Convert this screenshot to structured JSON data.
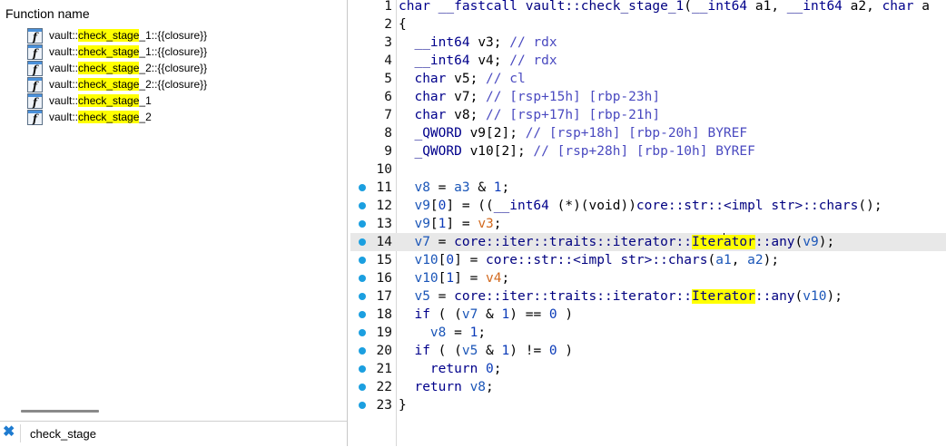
{
  "function_panel": {
    "header": "Function name",
    "search_highlight": "check_stage",
    "functions": [
      {
        "prefix": "vault::",
        "match": "check_stage",
        "suffix": "_1::{{closure}}"
      },
      {
        "prefix": "vault::",
        "match": "check_stage",
        "suffix": "_1::{{closure}}"
      },
      {
        "prefix": "vault::",
        "match": "check_stage",
        "suffix": "_2::{{closure}}"
      },
      {
        "prefix": "vault::",
        "match": "check_stage",
        "suffix": "_2::{{closure}}"
      },
      {
        "prefix": "vault::",
        "match": "check_stage",
        "suffix": "_1"
      },
      {
        "prefix": "vault::",
        "match": "check_stage",
        "suffix": "_2"
      }
    ],
    "function_icon": "function-icon",
    "filter": {
      "value": "check_stage",
      "clear_icon": "close-x-icon"
    }
  },
  "colors": {
    "highlight": "#ffff00",
    "breakpoint_dot": "#1b9fe0",
    "current_line": "#e8e8e8"
  },
  "code_view": {
    "current_line": 14,
    "lines": [
      {
        "n": "1",
        "dot": false,
        "segs": [
          [
            "kw",
            "char __fastcall "
          ],
          [
            "fn",
            "vault::check_stage_1"
          ],
          [
            "",
            "("
          ],
          [
            "kw",
            "__int64 "
          ],
          [
            "",
            "a1, "
          ],
          [
            "kw",
            "__int64 "
          ],
          [
            "",
            "a2, "
          ],
          [
            "kw",
            "char "
          ],
          [
            "",
            "a"
          ]
        ]
      },
      {
        "n": "2",
        "dot": false,
        "segs": [
          [
            "",
            "{"
          ]
        ]
      },
      {
        "n": "3",
        "dot": false,
        "segs": [
          [
            "kw",
            "  __int64 "
          ],
          [
            "",
            "v3; "
          ],
          [
            "cmt",
            "// rdx"
          ]
        ]
      },
      {
        "n": "4",
        "dot": false,
        "segs": [
          [
            "kw",
            "  __int64 "
          ],
          [
            "",
            "v4; "
          ],
          [
            "cmt",
            "// rdx"
          ]
        ]
      },
      {
        "n": "5",
        "dot": false,
        "segs": [
          [
            "kw",
            "  char "
          ],
          [
            "",
            "v5; "
          ],
          [
            "cmt",
            "// cl"
          ]
        ]
      },
      {
        "n": "6",
        "dot": false,
        "segs": [
          [
            "kw",
            "  char "
          ],
          [
            "",
            "v7; "
          ],
          [
            "cmt",
            "// [rsp+15h] [rbp-23h]"
          ]
        ]
      },
      {
        "n": "7",
        "dot": false,
        "segs": [
          [
            "kw",
            "  char "
          ],
          [
            "",
            "v8; "
          ],
          [
            "cmt",
            "// [rsp+17h] [rbp-21h]"
          ]
        ]
      },
      {
        "n": "8",
        "dot": false,
        "segs": [
          [
            "kw",
            "  _QWORD "
          ],
          [
            "",
            "v9[2]; "
          ],
          [
            "cmt",
            "// [rsp+18h] [rbp-20h] BYREF"
          ]
        ]
      },
      {
        "n": "9",
        "dot": false,
        "segs": [
          [
            "kw",
            "  _QWORD "
          ],
          [
            "",
            "v10[2]; "
          ],
          [
            "cmt",
            "// [rsp+28h] [rbp-10h] BYREF"
          ]
        ]
      },
      {
        "n": "10",
        "dot": false,
        "segs": []
      },
      {
        "n": "11",
        "dot": true,
        "segs": [
          [
            "var",
            "  v8"
          ],
          [
            "",
            " = "
          ],
          [
            "var",
            "a3"
          ],
          [
            "",
            " & "
          ],
          [
            "num",
            "1"
          ],
          [
            "",
            ";"
          ]
        ]
      },
      {
        "n": "12",
        "dot": true,
        "segs": [
          [
            "var",
            "  v9"
          ],
          [
            "",
            "["
          ],
          [
            "num",
            "0"
          ],
          [
            "",
            "] = (("
          ],
          [
            "kw",
            "__int64"
          ],
          [
            "",
            " (*)(void))"
          ],
          [
            "fn",
            "core::str::<impl str>::chars"
          ],
          [
            "",
            "();"
          ]
        ]
      },
      {
        "n": "13",
        "dot": true,
        "segs": [
          [
            "var",
            "  v9"
          ],
          [
            "",
            "["
          ],
          [
            "num",
            "1"
          ],
          [
            "",
            "] = "
          ],
          [
            "org",
            "v3"
          ],
          [
            "",
            ";"
          ]
        ]
      },
      {
        "n": "14",
        "dot": true,
        "segs": [
          [
            "var",
            "  v7"
          ],
          [
            "",
            " = "
          ],
          [
            "fn",
            "core::iter::traits::iterator::"
          ],
          [
            "hl",
            "Iter"
          ],
          [
            "caret",
            ""
          ],
          [
            "hl",
            "ator"
          ],
          [
            "fn",
            "::any"
          ],
          [
            "",
            "("
          ],
          [
            "var",
            "v9"
          ],
          [
            "",
            ");"
          ]
        ]
      },
      {
        "n": "15",
        "dot": true,
        "segs": [
          [
            "var",
            "  v10"
          ],
          [
            "",
            "["
          ],
          [
            "num",
            "0"
          ],
          [
            "",
            "] = "
          ],
          [
            "fn",
            "core::str::<impl str>::chars"
          ],
          [
            "",
            "("
          ],
          [
            "var",
            "a1"
          ],
          [
            "",
            ", "
          ],
          [
            "var",
            "a2"
          ],
          [
            "",
            ");"
          ]
        ]
      },
      {
        "n": "16",
        "dot": true,
        "segs": [
          [
            "var",
            "  v10"
          ],
          [
            "",
            "["
          ],
          [
            "num",
            "1"
          ],
          [
            "",
            "] = "
          ],
          [
            "org",
            "v4"
          ],
          [
            "",
            ";"
          ]
        ]
      },
      {
        "n": "17",
        "dot": true,
        "segs": [
          [
            "var",
            "  v5"
          ],
          [
            "",
            " = "
          ],
          [
            "fn",
            "core::iter::traits::iterator::"
          ],
          [
            "hl",
            "Iterator"
          ],
          [
            "fn",
            "::any"
          ],
          [
            "",
            "("
          ],
          [
            "var",
            "v10"
          ],
          [
            "",
            ");"
          ]
        ]
      },
      {
        "n": "18",
        "dot": true,
        "segs": [
          [
            "kw",
            "  if"
          ],
          [
            "",
            " ( ("
          ],
          [
            "var",
            "v7"
          ],
          [
            "",
            " & "
          ],
          [
            "num",
            "1"
          ],
          [
            "",
            ") == "
          ],
          [
            "num",
            "0"
          ],
          [
            "",
            " )"
          ]
        ]
      },
      {
        "n": "19",
        "dot": true,
        "segs": [
          [
            "var",
            "    v8"
          ],
          [
            "",
            " = "
          ],
          [
            "num",
            "1"
          ],
          [
            "",
            ";"
          ]
        ]
      },
      {
        "n": "20",
        "dot": true,
        "segs": [
          [
            "kw",
            "  if"
          ],
          [
            "",
            " ( ("
          ],
          [
            "var",
            "v5"
          ],
          [
            "",
            " & "
          ],
          [
            "num",
            "1"
          ],
          [
            "",
            ") != "
          ],
          [
            "num",
            "0"
          ],
          [
            "",
            " )"
          ]
        ]
      },
      {
        "n": "21",
        "dot": true,
        "segs": [
          [
            "kw",
            "    return "
          ],
          [
            "num",
            "0"
          ],
          [
            "",
            ";"
          ]
        ]
      },
      {
        "n": "22",
        "dot": true,
        "segs": [
          [
            "kw",
            "  return "
          ],
          [
            "var",
            "v8"
          ],
          [
            "",
            ";"
          ]
        ]
      },
      {
        "n": "23",
        "dot": true,
        "segs": [
          [
            "",
            "}"
          ]
        ]
      }
    ]
  }
}
